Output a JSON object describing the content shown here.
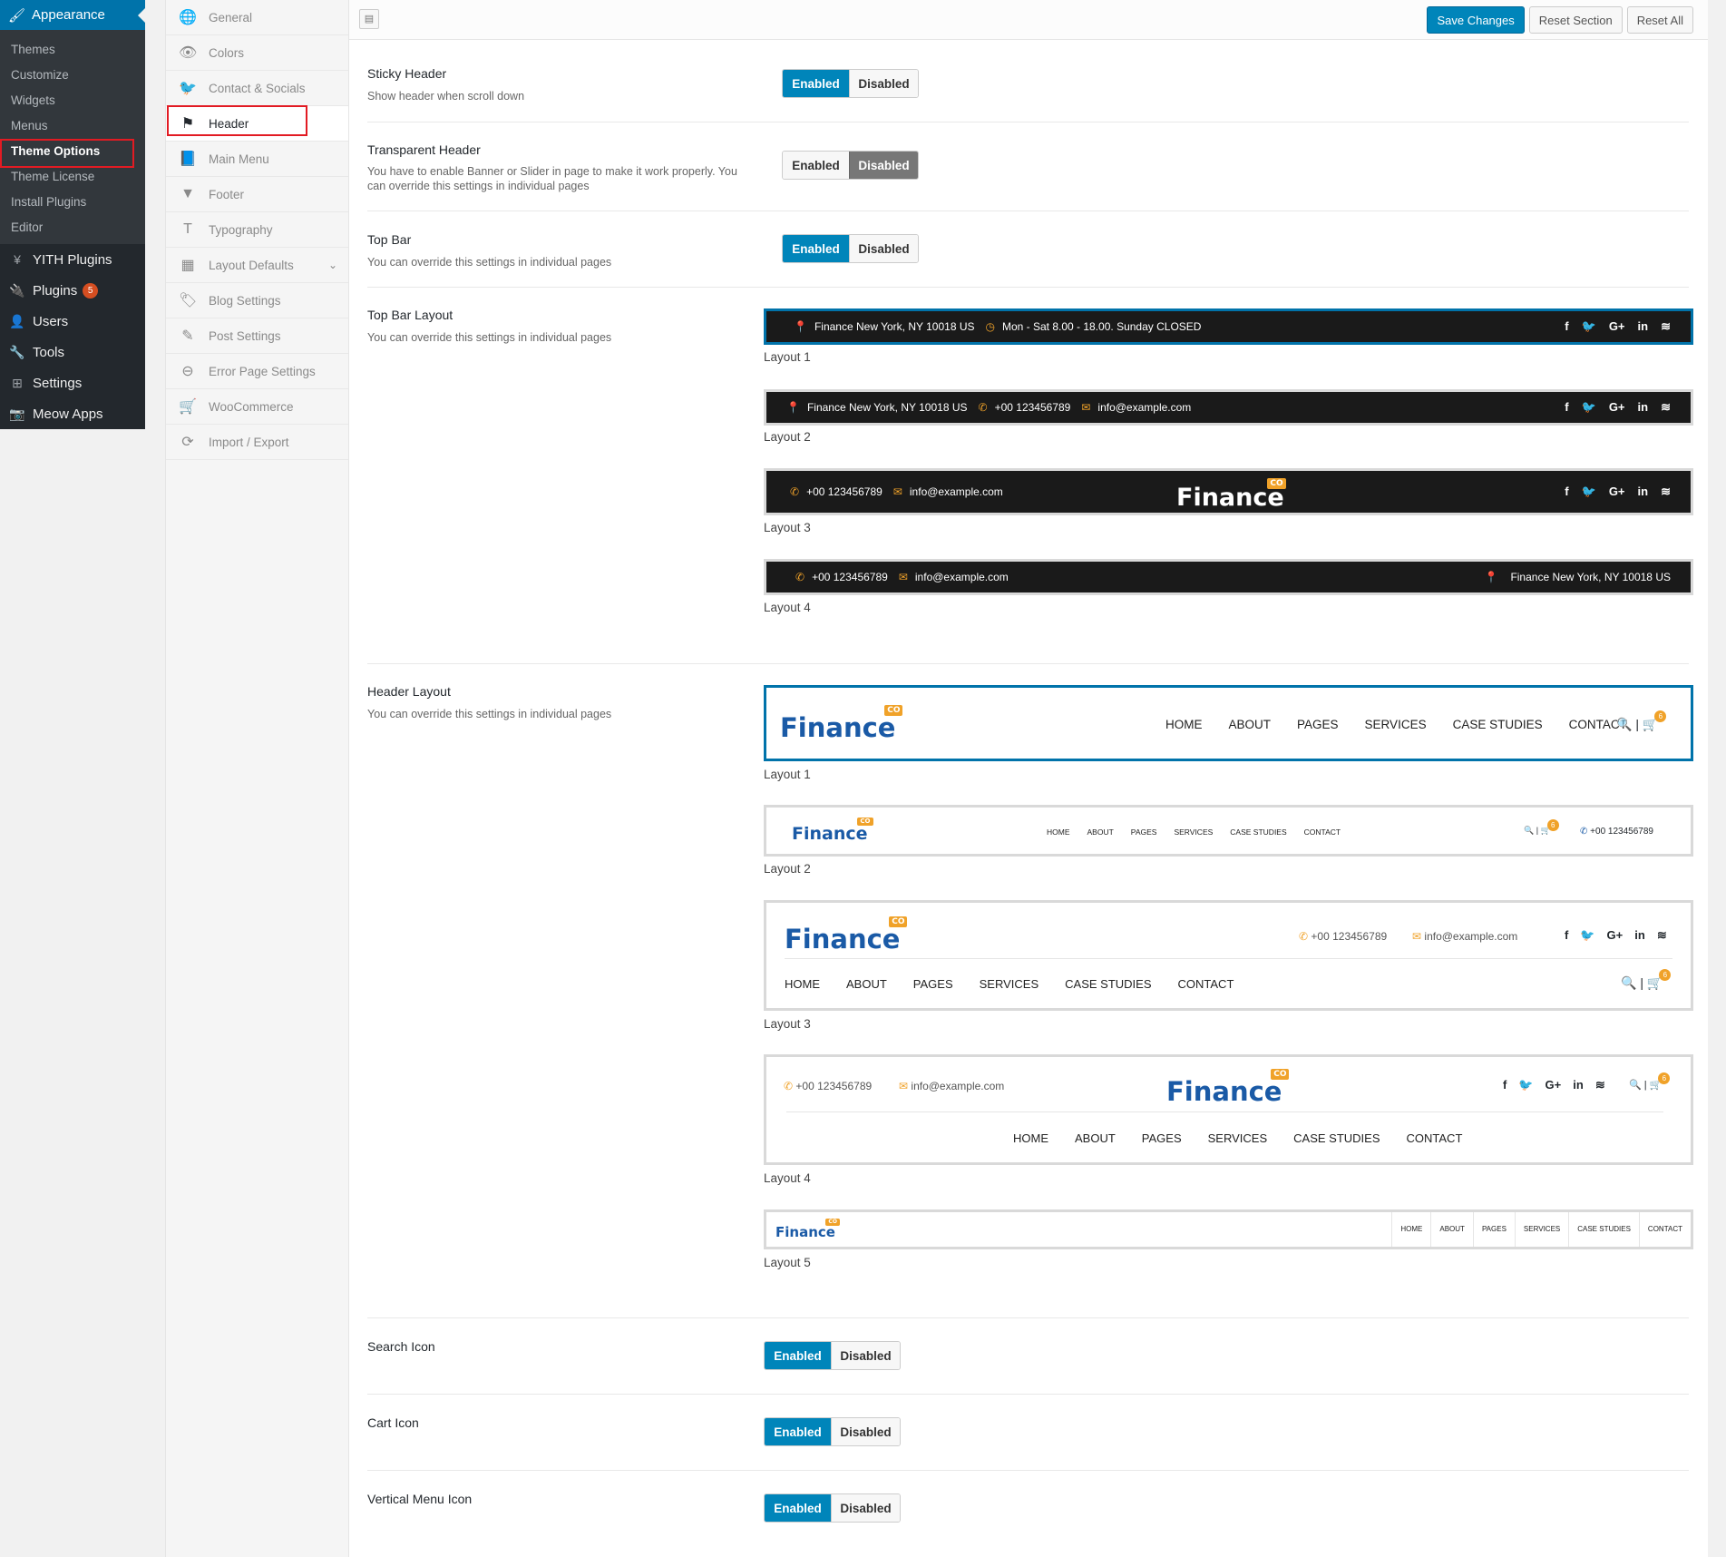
{
  "wp_menu": {
    "top": {
      "label": "Appearance",
      "icon": "paintbrush-icon"
    },
    "sub": [
      "Themes",
      "Customize",
      "Widgets",
      "Menus",
      "Theme Options",
      "Theme License",
      "Install Plugins",
      "Editor"
    ],
    "main": [
      {
        "label": "YITH Plugins",
        "icon": "yith-icon"
      },
      {
        "label": "Plugins",
        "icon": "plugin-icon",
        "badge": "5"
      },
      {
        "label": "Users",
        "icon": "user-icon"
      },
      {
        "label": "Tools",
        "icon": "wrench-icon"
      },
      {
        "label": "Settings",
        "icon": "settings-icon"
      },
      {
        "label": "Meow Apps",
        "icon": "camera-icon"
      }
    ]
  },
  "options_nav": [
    {
      "label": "General",
      "icon": "globe-icon"
    },
    {
      "label": "Colors",
      "icon": "eye-icon"
    },
    {
      "label": "Contact & Socials",
      "icon": "twitter-icon"
    },
    {
      "label": "Header",
      "icon": "flag-icon"
    },
    {
      "label": "Main Menu",
      "icon": "book-icon"
    },
    {
      "label": "Footer",
      "icon": "triangle-down-icon"
    },
    {
      "label": "Typography",
      "icon": "text-icon"
    },
    {
      "label": "Layout Defaults",
      "icon": "grid-icon"
    },
    {
      "label": "Blog Settings",
      "icon": "tags-icon"
    },
    {
      "label": "Post Settings",
      "icon": "edit-icon"
    },
    {
      "label": "Error Page Settings",
      "icon": "minus-circle-icon"
    },
    {
      "label": "WooCommerce",
      "icon": "cart-icon"
    },
    {
      "label": "Import / Export",
      "icon": "refresh-icon"
    }
  ],
  "toolbar": {
    "save": "Save Changes",
    "reset_section": "Reset Section",
    "reset_all": "Reset All"
  },
  "toggle": {
    "on": "Enabled",
    "off": "Disabled"
  },
  "sections": {
    "sticky": {
      "label": "Sticky Header",
      "desc": "Show header when scroll down"
    },
    "transparent": {
      "label": "Transparent Header",
      "desc": "You have to enable Banner or Slider in page to make it work properly. You can override this settings in individual pages"
    },
    "topbar": {
      "label": "Top Bar",
      "desc": "You can override this settings in individual pages"
    },
    "topbar_layout": {
      "label": "Top Bar Layout",
      "desc": "You can override this settings in individual pages"
    },
    "header_layout": {
      "label": "Header Layout",
      "desc": "You can override this settings in individual pages"
    },
    "search": {
      "label": "Search Icon"
    },
    "cart": {
      "label": "Cart Icon"
    },
    "vertical": {
      "label": "Vertical Menu Icon"
    }
  },
  "layout_captions": [
    "Layout 1",
    "Layout 2",
    "Layout 3",
    "Layout 4",
    "Layout 5"
  ],
  "preview": {
    "address": "Finance New York, NY 10018 US",
    "hours": "Mon - Sat 8.00 - 18.00. Sunday CLOSED",
    "phone": "+00 123456789",
    "email": "info@example.com",
    "logo": "Finance",
    "logo_badge": "CO",
    "cart_count": "6",
    "menu": [
      "HOME",
      "ABOUT",
      "PAGES",
      "SERVICES",
      "CASE STUDIES",
      "CONTACT"
    ],
    "socials": [
      "f",
      "t",
      "G+",
      "in",
      "rss"
    ]
  },
  "colors": {
    "accent": "#0085ba",
    "orange": "#f0a229",
    "logo": "#1a5aa6",
    "red_highlight": "#e21b23"
  }
}
